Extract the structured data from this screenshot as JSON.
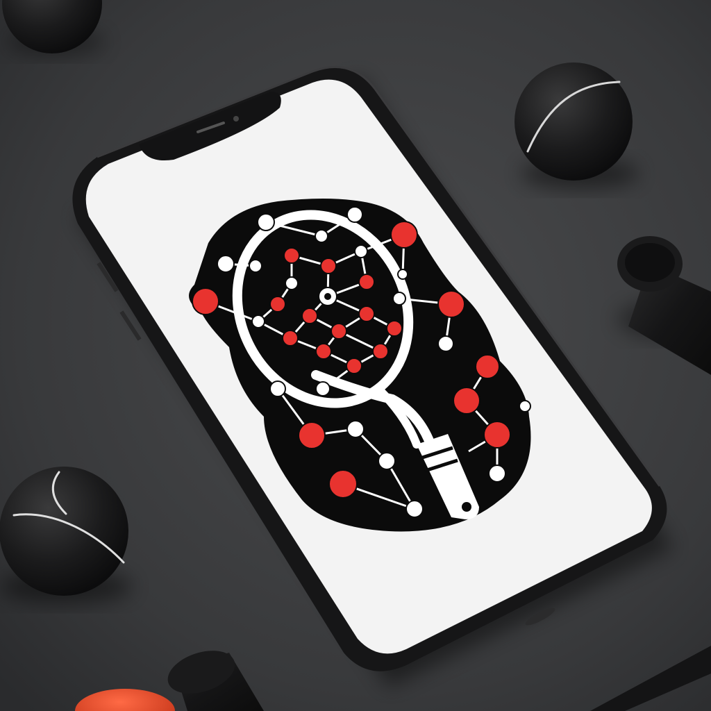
{
  "scene": {
    "subject": "smartphone",
    "screen_content": "logo",
    "logo_icon": "tennis-racket-network-icon",
    "props": [
      "tennis-ball",
      "tennis-ball",
      "tennis-ball",
      "handle-grip",
      "handle-grip",
      "orange-ball"
    ]
  },
  "colors": {
    "surface": "#3a3b3d",
    "phone_frame": "#1b1b1c",
    "screen": "#f3f3f3",
    "logo_fill": "#0b0b0b",
    "racket": "#ffffff",
    "node_red": "#e8332f",
    "node_white": "#ffffff",
    "ball": "#1c1c1c",
    "ball_seam": "#d9d9d9",
    "accent_orange": "#e64a2c"
  }
}
